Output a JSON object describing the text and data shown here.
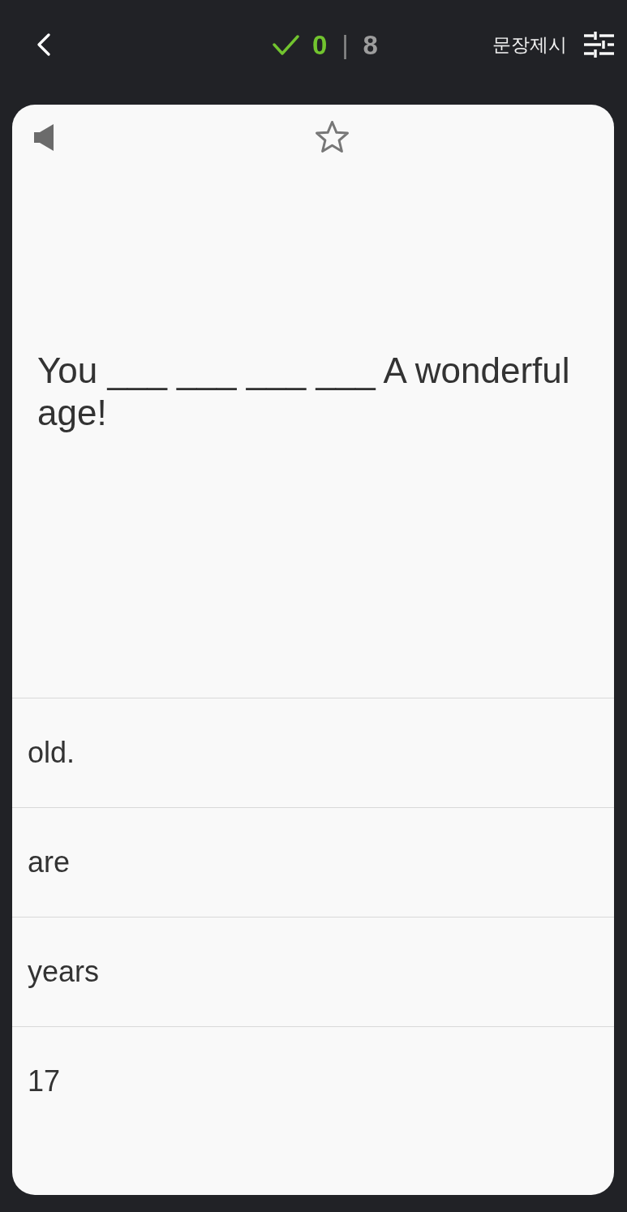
{
  "score": {
    "correct": "0",
    "separator": "|",
    "total": "8"
  },
  "mode_label": "문장제시",
  "card": {
    "bookmarked": false,
    "sentence": "You ___ ___ ___ ___ A wonderful age!",
    "choices": [
      {
        "text": "old."
      },
      {
        "text": "are"
      },
      {
        "text": "years"
      },
      {
        "text": "17"
      }
    ]
  }
}
